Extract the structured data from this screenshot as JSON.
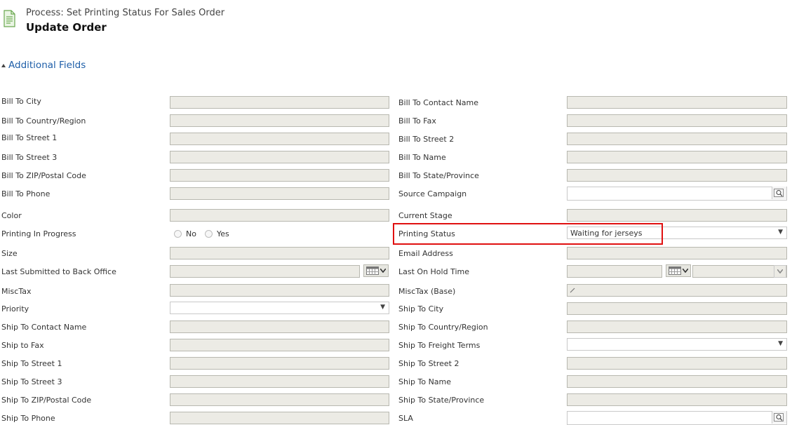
{
  "header": {
    "process_title": "Process: Set Printing Status For Sales Order",
    "form_title": "Update Order",
    "section_label": "Additional Fields"
  },
  "left_fields": [
    {
      "label": "Bill To City"
    },
    {
      "label": "Bill To Country/Region"
    },
    {
      "label": "Bill To Street 1"
    },
    {
      "label": "Bill To Street 3"
    },
    {
      "label": "Bill To ZIP/Postal Code"
    },
    {
      "label": "Bill To Phone"
    },
    {
      "label": "Color"
    },
    {
      "label": "Printing In Progress",
      "options": [
        "No",
        "Yes"
      ]
    },
    {
      "label": "Size"
    },
    {
      "label": "Last Submitted to Back Office"
    },
    {
      "label": "MiscTax"
    },
    {
      "label": "Priority"
    },
    {
      "label": "Ship To Contact Name"
    },
    {
      "label": "Ship to Fax"
    },
    {
      "label": "Ship To Street 1"
    },
    {
      "label": "Ship To Street 3"
    },
    {
      "label": "Ship To ZIP/Postal Code"
    },
    {
      "label": "Ship To Phone"
    }
  ],
  "right_fields": [
    {
      "label": "Bill To Contact Name"
    },
    {
      "label": "Bill To Fax"
    },
    {
      "label": "Bill To Street 2"
    },
    {
      "label": "Bill To Name"
    },
    {
      "label": "Bill To State/Province"
    },
    {
      "label": "Source Campaign"
    },
    {
      "label": "Current Stage"
    },
    {
      "label": "Printing Status",
      "value": "Waiting for jerseys"
    },
    {
      "label": "Email Address"
    },
    {
      "label": "Last On Hold Time"
    },
    {
      "label": "MiscTax (Base)"
    },
    {
      "label": "Ship To City"
    },
    {
      "label": "Ship To Country/Region"
    },
    {
      "label": "Ship To Freight Terms"
    },
    {
      "label": "Ship To Street 2"
    },
    {
      "label": "Ship To Name"
    },
    {
      "label": "Ship To State/Province"
    },
    {
      "label": "SLA"
    }
  ],
  "colors": {
    "accent": "#1e5ea8",
    "highlight": "#e01010",
    "readonly_fill": "#ecebe5"
  },
  "icons": [
    "process-form-icon",
    "expand-triangle-icon",
    "lookup-icon",
    "calendar-icon",
    "dropdown-caret-icon"
  ]
}
